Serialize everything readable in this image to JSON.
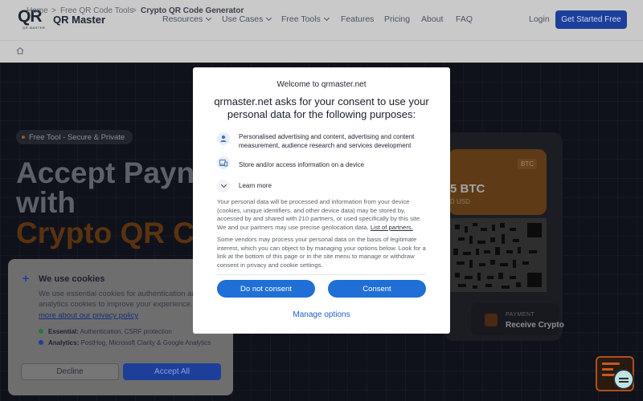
{
  "header": {
    "logo_text": "QR Master",
    "logo_mark": "QR",
    "logo_sub": "QR MASTER",
    "nav": [
      {
        "label": "Resources",
        "dropdown": true
      },
      {
        "label": "Use Cases",
        "dropdown": true
      },
      {
        "label": "Free Tools",
        "dropdown": true
      },
      {
        "label": "Features",
        "dropdown": false
      },
      {
        "label": "Pricing",
        "dropdown": false
      },
      {
        "label": "About",
        "dropdown": false
      },
      {
        "label": "FAQ",
        "dropdown": false
      }
    ],
    "login": "Login",
    "cta": "Get Started Free"
  },
  "breadcrumb": {
    "items": [
      "Home",
      "Free QR Code Tools",
      "Crypto QR Code Generator"
    ],
    "separator": ">"
  },
  "hero": {
    "badge": "Free Tool - Secure & Private",
    "title_line1": "Accept Payn",
    "title_line2": "with",
    "title_line3": "Crypto QR Co",
    "card": {
      "amount": "5 BTC",
      "usd": "D USD",
      "tag": "BTC",
      "payment_label": "PAYMENT",
      "payment_value": "Receive Crypto"
    }
  },
  "cookie_banner": {
    "title": "We use cookies",
    "body": "We use essential cookies for authentication and analytics cookies to improve your experience.",
    "link": "more about our privacy policy",
    "essential_label": "Essential:",
    "essential_text": "Authentication, CSRF protection",
    "analytics_label": "Analytics:",
    "analytics_text": "PostHog, Microsoft Clarity & Google Analytics",
    "decline": "Decline",
    "accept_all": "Accept All"
  },
  "consent_modal": {
    "welcome": "Welcome to qrmaster.net",
    "heading": "qrmaster.net asks for your consent to use your personal data for the following purposes:",
    "purposes": [
      {
        "icon": "user-icon",
        "text": "Personalised advertising and content, advertising and content measurement, audience research and services development"
      },
      {
        "icon": "device-icon",
        "text": "Store and/or access information on a device"
      }
    ],
    "learn_more": "Learn more",
    "para1": "Your personal data will be processed and information from your device (cookies, unique identifiers, and other device data) may be stored by, accessed by and shared with 210 partners, or used specifically by this site. We and our partners may use precise geolocation data.",
    "partners_link": "List of partners.",
    "para2": "Some vendors may process your personal data on the basis of legitimate interest, which you can object to by managing your options below. Look for a link at the bottom of this page or in the site menu to manage or withdraw consent in privacy and cookie settings.",
    "do_not_consent": "Do not consent",
    "consent": "Consent",
    "manage_options": "Manage options"
  },
  "colors": {
    "primary_blue": "#1f6fd6",
    "brand_navy": "#1d3f9a",
    "hero_bg": "#0f121a",
    "accent_orange": "#5a3210"
  }
}
